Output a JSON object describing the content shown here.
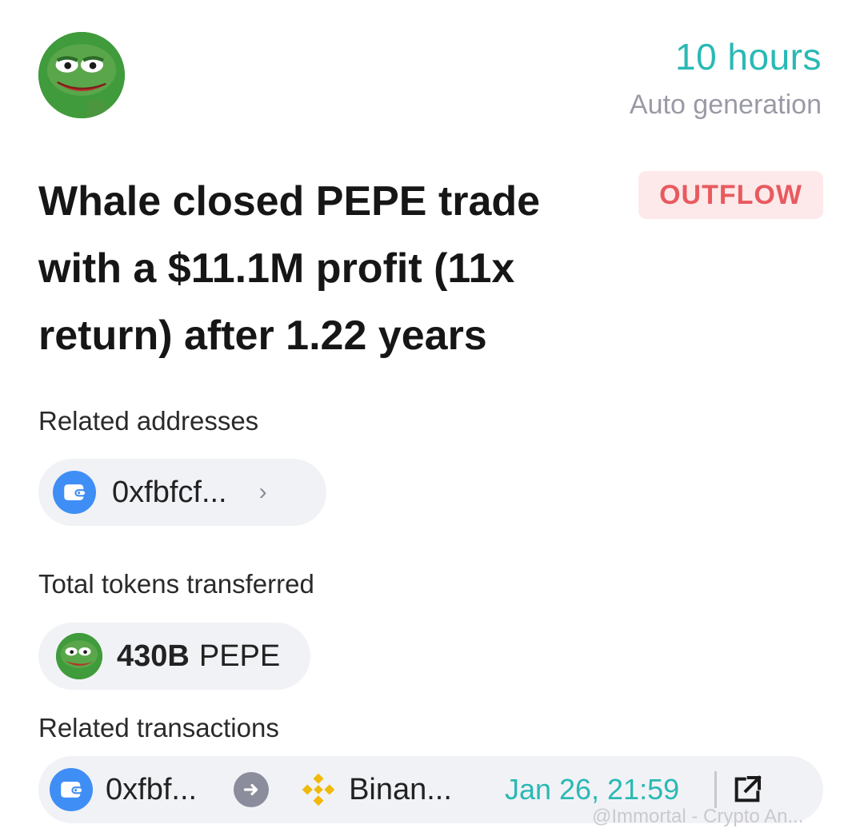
{
  "header": {
    "avatar_icon": "pepe-frog-avatar",
    "time_ago": "10 hours",
    "source": "Auto generation"
  },
  "alert": {
    "title": "Whale closed PEPE trade with a $11.1M profit (11x return) after 1.22 years",
    "badge": "OUTFLOW",
    "badge_color": "#e85a5f",
    "badge_bg": "#fde9ea"
  },
  "related_addresses": {
    "label": "Related addresses",
    "items": [
      {
        "icon": "wallet-icon",
        "address": "0xfbfcf...",
        "chevron": "chevron-right-icon"
      }
    ]
  },
  "tokens": {
    "label": "Total tokens transferred",
    "amount": "430B",
    "symbol": "PEPE",
    "icon": "pepe-token-icon"
  },
  "related_transactions": {
    "label": "Related transactions",
    "items": [
      {
        "from_icon": "wallet-icon",
        "from": "0xfbf...",
        "direction_icon": "arrow-right-icon",
        "to_icon": "binance-icon",
        "to": "Binan...",
        "date": "Jan 26, 21:59",
        "action_icon": "external-link-icon"
      }
    ]
  },
  "watermark": "@Immortal - Crypto An...",
  "colors": {
    "accent_teal": "#2ab9b4",
    "wallet_blue": "#3f8ef5",
    "binance_yellow": "#f0b90b",
    "pill_bg": "#f1f2f6"
  }
}
